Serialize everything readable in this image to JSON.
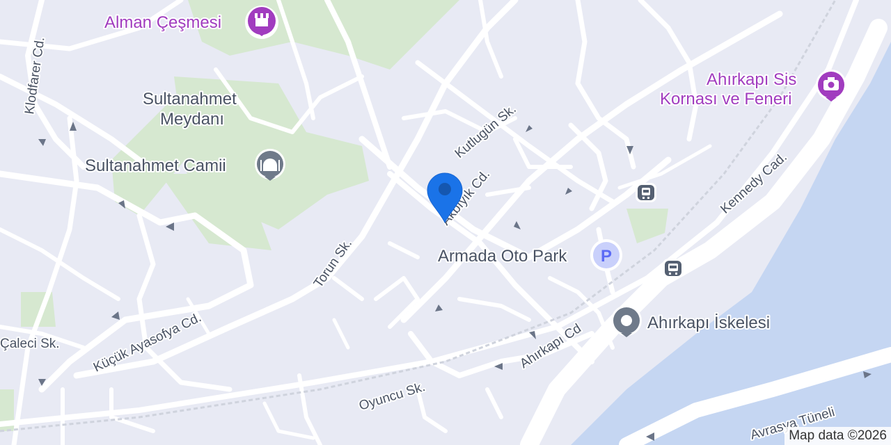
{
  "map": {
    "colors": {
      "land": "#e8eaf4",
      "water": "#c5d6f2",
      "park": "#d6e8d0",
      "road": "#ffffff",
      "pin": "#1a73e8",
      "poi_purple": "#a13cbf",
      "parking": "#5c6bf5"
    },
    "streets": {
      "klodfarer": "Klodfarer Cd.",
      "kutlugun": "Kutlugün Sk.",
      "akbiyik": "Akbıyık Cd.",
      "torun": "Torun Sk.",
      "kucuk_ayasofya": "Küçük Ayasofya Cd.",
      "kennedy": "Kennedy Cad.",
      "ahirkapi_cd": "Ahırkapı Cd",
      "oyuncu": "Oyuncu Sk.",
      "caleci": "Çaleci Sk.",
      "avrasya": "Avrasya Tüneli"
    },
    "pois": {
      "alman_cesmesi": {
        "label": "Alman Çeşmesi",
        "icon": "fountain-icon"
      },
      "sultanahmet_meydani": {
        "line1": "Sultanahmet",
        "line2": "Meydanı"
      },
      "sultanahmet_camii": {
        "label": "Sultanahmet Camii",
        "icon": "mosque-icon"
      },
      "ahirkapi_sis": {
        "line1": "Ahırkapı Sis",
        "line2": "Kornası ve Feneri",
        "icon": "camera-icon"
      },
      "armada_oto_park": {
        "label": "Armada Oto Park",
        "icon": "parking-icon",
        "icon_text": "P"
      },
      "ahirkapi_iskelesi": {
        "label": "Ahırkapı İskelesi",
        "icon": "ferry-pier-icon"
      }
    },
    "transit": {
      "tram": "tram-icon",
      "bus": "bus-icon"
    },
    "attribution": "Map data ©2026"
  }
}
